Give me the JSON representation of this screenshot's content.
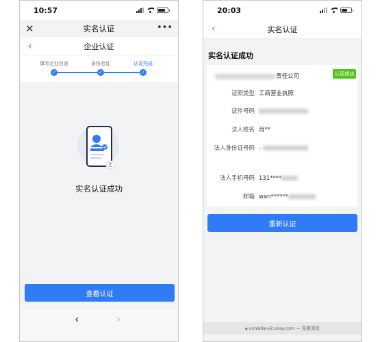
{
  "left_screen": {
    "status_time": "10:57",
    "title": "实名认证",
    "subtitle": "企业认证",
    "steps": [
      {
        "label": "填写企业信息"
      },
      {
        "label": "身份验证"
      },
      {
        "label": "认证完成"
      }
    ],
    "success_text": "实名认证成功",
    "button_label": "查看认证",
    "icons": {
      "close": "close-icon",
      "more": "more-dots-icon",
      "back": "chevron-left-icon",
      "forward": "chevron-right-icon"
    }
  },
  "right_screen": {
    "status_time": "20:03",
    "title": "实名认证",
    "section_title": "实名认证成功",
    "company_suffix": "责任公司",
    "badge": "认证成功",
    "fields": [
      {
        "key": "证照类型",
        "value": "工商营业执照"
      },
      {
        "key": "证件号码",
        "value": ""
      },
      {
        "key": "法人姓名",
        "value": "肖**"
      },
      {
        "key": "法人身份证号码",
        "value": "-"
      },
      {
        "key": "法人手机号码",
        "value": "131****"
      },
      {
        "key": "邮箱",
        "value": "wan******"
      }
    ],
    "button_label": "重新认证",
    "url_host": "console-v2.oray.com",
    "url_suffix": "— 无痕浏览"
  },
  "colors": {
    "accent": "#2f7cf6",
    "success_badge": "#52c41a",
    "page_bg": "#f2f3f5"
  }
}
